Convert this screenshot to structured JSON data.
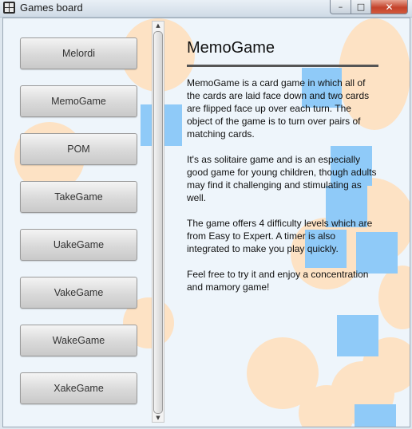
{
  "window": {
    "title": "Games board",
    "controls": {
      "minimize": "–",
      "maximize": "□",
      "close": "✕"
    }
  },
  "games": [
    {
      "label": "Melordi"
    },
    {
      "label": "MemoGame"
    },
    {
      "label": "POM"
    },
    {
      "label": "TakeGame"
    },
    {
      "label": "UakeGame"
    },
    {
      "label": "VakeGame"
    },
    {
      "label": "WakeGame"
    },
    {
      "label": "XakeGame"
    }
  ],
  "scrollbar": {
    "up_arrow": "▲",
    "down_arrow": "▼"
  },
  "details": {
    "title": "MemoGame",
    "paragraphs": [
      "MemoGame is a card game in which all of the cards are laid face down and two cards are flipped face up over each turn. The object of the game is to turn over pairs of matching cards.",
      "It's as solitaire game and is an especially good game for young children, though adults may find it challenging and stimulating as well.",
      "The game offers 4 difficulty levels which are from Easy to Expert. A timer is also integrated to make you play quickly.",
      "Feel free to try it and enjoy a concentration and mamory game!"
    ]
  },
  "colors": {
    "background": "#eef5fb",
    "circle": "#fde2c4",
    "square": "#8fcaf8"
  }
}
